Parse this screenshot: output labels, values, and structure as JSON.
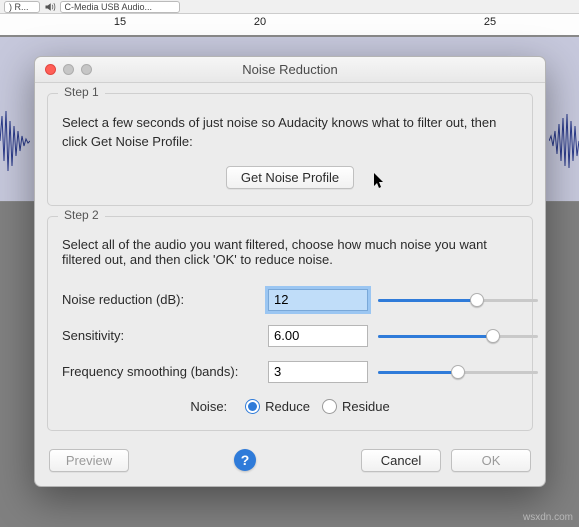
{
  "background": {
    "dropdown1_text": ")  R...",
    "dropdown2_text": "C-Media USB Audio...",
    "ruler_ticks": {
      "15": "15",
      "20": "20",
      "25": "25"
    }
  },
  "dialog": {
    "title": "Noise Reduction",
    "step1": {
      "legend": "Step 1",
      "instructions": "Select a few seconds of just noise so Audacity knows what to filter out, then click Get Noise Profile:",
      "button": "Get Noise Profile"
    },
    "step2": {
      "legend": "Step 2",
      "instructions": "Select all of the audio you want filtered, choose how much noise you want filtered out, and then click 'OK' to reduce noise.",
      "nr_label": "Noise reduction (dB):",
      "nr_value": "12",
      "sens_label": "Sensitivity:",
      "sens_value": "6.00",
      "freq_label": "Frequency smoothing (bands):",
      "freq_value": "3",
      "noise_label": "Noise:",
      "reduce_label": "Reduce",
      "residue_label": "Residue"
    },
    "buttons": {
      "preview": "Preview",
      "cancel": "Cancel",
      "ok": "OK",
      "help": "?"
    }
  },
  "colors": {
    "accent": "#2f7bd9",
    "dialog_bg": "#ececec",
    "track_bg": "#c6c8dc"
  },
  "watermark": "wsxdn.com"
}
